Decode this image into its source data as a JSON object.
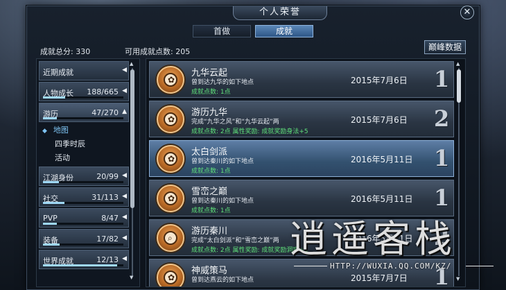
{
  "window": {
    "title": "个人荣誉",
    "close_icon": "close-icon"
  },
  "tabs": [
    {
      "label": "首做",
      "active": false
    },
    {
      "label": "成就",
      "active": true
    }
  ],
  "stats": {
    "total_label": "成就总分:",
    "total_value": "330",
    "available_label": "可用成就点数:",
    "available_value": "205"
  },
  "peak_button": "巅峰数据",
  "sidebar": {
    "recent": {
      "label": "近期成就"
    },
    "categories": [
      {
        "label": "人物成长",
        "count": "188/665",
        "progress": 0.28
      },
      {
        "label": "游历",
        "count": "47/270",
        "progress": 0.17,
        "open": true
      },
      {
        "label": "江湖身份",
        "count": "20/99",
        "progress": 0.2
      },
      {
        "label": "社交",
        "count": "31/113",
        "progress": 0.27
      },
      {
        "label": "PVP",
        "count": "8/47",
        "progress": 0.17
      },
      {
        "label": "装备",
        "count": "17/82",
        "progress": 0.21
      },
      {
        "label": "世界成就",
        "count": "12/13",
        "progress": 0.92
      }
    ],
    "subitems": [
      "地图",
      "四季时辰",
      "活动"
    ]
  },
  "achievements": [
    {
      "title": "九华云起",
      "desc": "曾到达九华的如下地点",
      "points": "成就点数: 1点",
      "date": "2015年7月6日",
      "rank": "1"
    },
    {
      "title": "游历九华",
      "desc": "完成“九华之风”和“九华云起”两",
      "points": "成就点数: 2点 属性奖励: 成就奖励身法+5",
      "date": "2015年7月6日",
      "rank": "2"
    },
    {
      "title": "太白剑派",
      "desc": "曾到达秦川的如下地点",
      "points": "成就点数: 1点",
      "date": "2016年5月11日",
      "rank": "1"
    },
    {
      "title": "雪峦之巅",
      "desc": "曾到达秦川的如下地点",
      "points": "成就点数: 1点",
      "date": "2016年5月11日",
      "rank": "1"
    },
    {
      "title": "游历秦川",
      "desc": "完成“太白剑派”和“雪峦之巅”两",
      "points": "成就点数: 2点 属性奖励: 成就奖励洞察+5",
      "date": "2016年5月11日",
      "rank": "2"
    },
    {
      "title": "神威策马",
      "desc": "曾到达燕云的如下地点",
      "points": "",
      "date": "2015年7月7日",
      "rank": "1"
    }
  ],
  "watermark": {
    "text": "逍遥客栈",
    "url": "HTTP://WUXIA.QQ.COM/KZ/"
  },
  "colors": {
    "accent": "#5b87b7",
    "points_green": "#5fe07b",
    "selected_sub": "#7ec3f2"
  }
}
